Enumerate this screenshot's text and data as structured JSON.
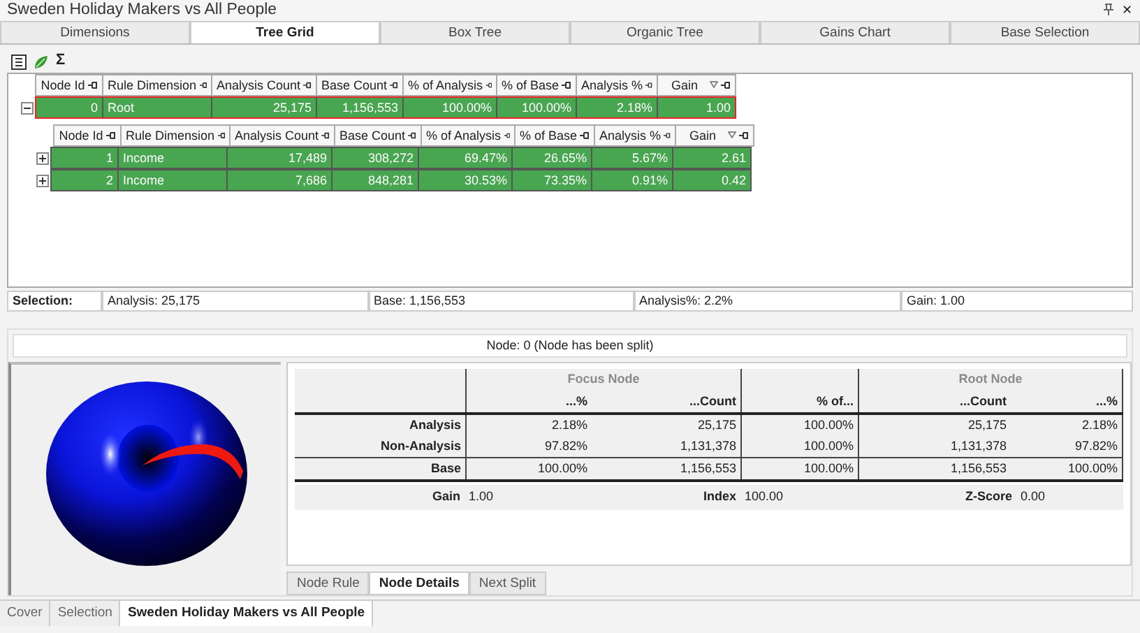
{
  "window": {
    "title": "Sweden Holiday Makers vs All People",
    "close": "✕"
  },
  "tabs": [
    {
      "label": "Dimensions",
      "selected": false
    },
    {
      "label": "Tree Grid",
      "selected": true
    },
    {
      "label": "Box Tree",
      "selected": false
    },
    {
      "label": "Organic Tree",
      "selected": false
    },
    {
      "label": "Gains Chart",
      "selected": false
    },
    {
      "label": "Base Selection",
      "selected": false
    }
  ],
  "toolbar": [
    {
      "kind": "list"
    },
    {
      "kind": "leaf"
    },
    {
      "kind": "glyph",
      "label": "Σ"
    }
  ],
  "grid": {
    "columns": [
      {
        "label": "Node Id",
        "filter": false
      },
      {
        "label": "Rule Dimension",
        "filter": false
      },
      {
        "label": "Analysis Count",
        "filter": false
      },
      {
        "label": "Base Count",
        "filter": false
      },
      {
        "label": "% of Analysis",
        "filter": false
      },
      {
        "label": "% of Base",
        "filter": false
      },
      {
        "label": "Analysis %",
        "filter": false
      },
      {
        "label": "Gain",
        "filter": true
      }
    ],
    "root": {
      "expanded": true,
      "selected": true,
      "cells": [
        "0",
        "Root",
        "25,175",
        "1,156,553",
        "100.00%",
        "100.00%",
        "2.18%",
        "1.00"
      ]
    },
    "child_columns": [
      {
        "label": "Node Id",
        "filter": false
      },
      {
        "label": "Rule Dimension",
        "filter": false
      },
      {
        "label": "Analysis Count",
        "filter": false
      },
      {
        "label": "Base Count",
        "filter": false
      },
      {
        "label": "% of Analysis",
        "filter": false
      },
      {
        "label": "% of Base",
        "filter": false
      },
      {
        "label": "Analysis %",
        "filter": false
      },
      {
        "label": "Gain",
        "filter": true
      }
    ],
    "children": [
      {
        "expanded": false,
        "selected": false,
        "cells": [
          "1",
          "Income",
          "17,489",
          "308,272",
          "69.47%",
          "26.65%",
          "5.67%",
          "2.61"
        ]
      },
      {
        "expanded": false,
        "selected": false,
        "cells": [
          "2",
          "Income",
          "7,686",
          "848,281",
          "30.53%",
          "73.35%",
          "0.91%",
          "0.42"
        ]
      }
    ]
  },
  "selection_bar": {
    "label": "Selection:",
    "fields": [
      "Analysis: 25,175",
      "Base: 1,156,553",
      "Analysis%: 2.2%",
      "Gain: 1.00"
    ]
  },
  "node_details": {
    "header": "Node: 0 (Node has been split)",
    "groups": [
      {
        "label": "Focus Node",
        "columns": [
          "...%",
          "...Count"
        ]
      },
      {
        "columns": [
          "% of..."
        ]
      },
      {
        "label": "Root Node",
        "columns": [
          "...Count",
          "...%"
        ]
      }
    ],
    "rows": [
      {
        "label": "Analysis",
        "cells": [
          "2.18%",
          "25,175",
          "100.00%",
          "25,175",
          "2.18%"
        ]
      },
      {
        "label": "Non-Analysis",
        "cells": [
          "97.82%",
          "1,131,378",
          "100.00%",
          "1,131,378",
          "97.82%"
        ]
      },
      {
        "label": "Base",
        "cells": [
          "100.00%",
          "1,156,553",
          "100.00%",
          "1,156,553",
          "100.00%"
        ]
      }
    ],
    "stats": [
      {
        "label": "Gain",
        "value": "1.00"
      },
      {
        "label": "Index",
        "value": "100.00"
      },
      {
        "label": "Z-Score",
        "value": "0.00"
      }
    ]
  },
  "detail_tabs": [
    {
      "label": "Node Rule",
      "selected": false
    },
    {
      "label": "Node Details",
      "selected": true
    },
    {
      "label": "Next Split",
      "selected": false
    }
  ],
  "sheet_tabs": [
    {
      "label": "Cover",
      "selected": false
    },
    {
      "label": "Selection",
      "selected": false
    },
    {
      "label": "Sweden Holiday Makers vs All People",
      "selected": true
    }
  ]
}
